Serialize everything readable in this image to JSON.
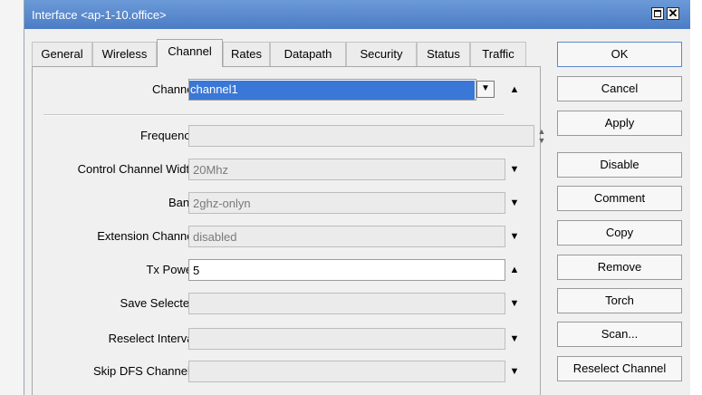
{
  "window": {
    "title": "Interface <ap-1-10.office>"
  },
  "tabs": [
    {
      "label": "General"
    },
    {
      "label": "Wireless"
    },
    {
      "label": "Channel"
    },
    {
      "label": "Rates"
    },
    {
      "label": "Datapath"
    },
    {
      "label": "Security"
    },
    {
      "label": "Status"
    },
    {
      "label": "Traffic"
    }
  ],
  "active_tab": "Channel",
  "fields": {
    "channel": {
      "label": "Channel:",
      "value": "channel1"
    },
    "frequency": {
      "label": "Frequency:",
      "value": ""
    },
    "control_channel_width": {
      "label": "Control Channel Width:",
      "value": "20Mhz"
    },
    "band": {
      "label": "Band:",
      "value": "2ghz-onlyn"
    },
    "extension_channel": {
      "label": "Extension Channel:",
      "value": "disabled"
    },
    "tx_power": {
      "label": "Tx Power:",
      "value": "5"
    },
    "save_selected": {
      "label": "Save Selected:",
      "value": ""
    },
    "reselect_interval": {
      "label": "Reselect Interval:",
      "value": ""
    },
    "skip_dfs_channels": {
      "label": "Skip DFS Channels:",
      "value": ""
    }
  },
  "buttons": {
    "ok": "OK",
    "cancel": "Cancel",
    "apply": "Apply",
    "disable": "Disable",
    "comment": "Comment",
    "copy": "Copy",
    "remove": "Remove",
    "torch": "Torch",
    "scan": "Scan...",
    "reselect_channel": "Reselect Channel"
  },
  "icons": {
    "dropdown": "triangle-down-icon",
    "collapse": "triangle-up-icon",
    "spinner": "up-down-icon",
    "maximize": "maximize-icon",
    "close": "close-icon"
  },
  "colors": {
    "title_bar": "#4b7cc4",
    "selection": "#3a77d6"
  }
}
